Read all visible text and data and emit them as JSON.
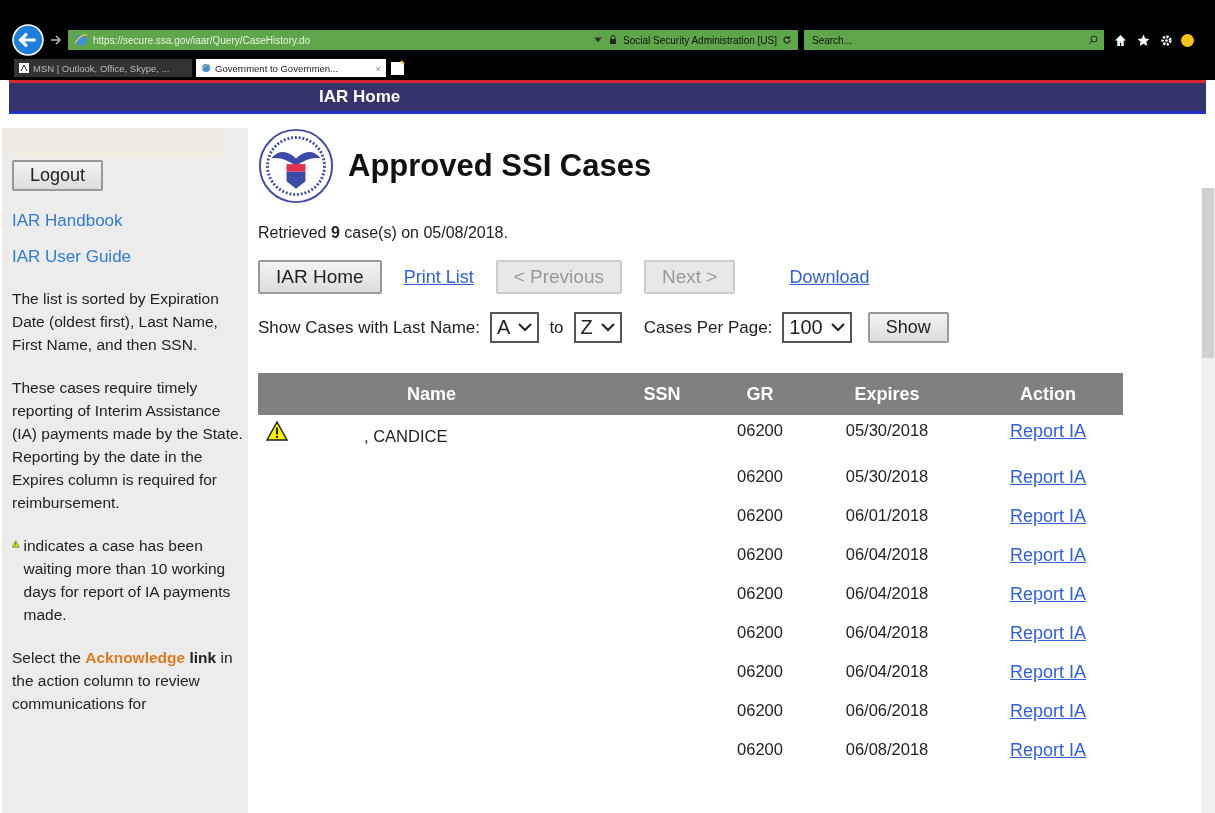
{
  "browser": {
    "url": "https://secure.ssa.gov/iaar/Query/CaseHistory.do",
    "site_identity": "Social Security Administration [US]",
    "search": {
      "placeholder": "Search..."
    },
    "tabs": [
      {
        "label": "MSN | Outlook, Office, Skype, ...",
        "selected": false
      },
      {
        "label": "Government to Governmen...",
        "selected": true,
        "close": "×"
      }
    ]
  },
  "nav_bar": {
    "label": "IAR Home"
  },
  "sidebar": {
    "logout": "Logout",
    "links": [
      "IAR Handbook",
      "IAR User Guide"
    ],
    "paragraphs": [
      {
        "kind": "text",
        "text": "The list is sorted by Expiration Date (oldest first), Last Name, First Name, and then SSN."
      },
      {
        "kind": "text",
        "text": "These cases require timely reporting of Interim Assistance (IA) payments made by the State. Reporting by the date in the Expires column is required for reimbursement."
      },
      {
        "kind": "warning",
        "text": "indicates a case has been waiting more than 10 working days for report of IA payments made."
      },
      {
        "kind": "highlight",
        "before": "Select the ",
        "highlight": "Acknowledge",
        "after": " **link** in the action column to review communications for"
      }
    ]
  },
  "page": {
    "title": "Approved SSI Cases",
    "summary": "Retrieved **9** case(s) on 05/08/2018.",
    "actions": [
      {
        "kind": "button",
        "label": "IAR Home",
        "disabled": false
      },
      {
        "kind": "link",
        "label": "Print List"
      },
      {
        "kind": "button",
        "label": "< Previous",
        "disabled": true
      },
      {
        "kind": "button",
        "label": "Next >",
        "disabled": true
      },
      {
        "kind": "link",
        "label": "Download"
      }
    ],
    "filter": {
      "label": "Show Cases with Last Name:",
      "from": "A",
      "to_label": "to",
      "to": "Z",
      "per_page_label": "Cases Per Page:",
      "per_page": "100",
      "show": "Show"
    }
  },
  "table": {
    "columns": [
      "Name",
      "SSN",
      "GR",
      "Expires",
      "Action"
    ],
    "rows": [
      {
        "warning": true,
        "name": ", CANDICE",
        "gr": "06200",
        "expires": "05/30/2018",
        "action": "Report IA"
      },
      {
        "warning": false,
        "gr": "06200",
        "expires": "05/30/2018",
        "action": "Report IA"
      },
      {
        "warning": false,
        "gr": "06200",
        "expires": "06/01/2018",
        "action": "Report IA"
      },
      {
        "warning": false,
        "gr": "06200",
        "expires": "06/04/2018",
        "action": "Report IA"
      },
      {
        "warning": false,
        "gr": "06200",
        "expires": "06/04/2018",
        "action": "Report IA"
      },
      {
        "warning": false,
        "gr": "06200",
        "expires": "06/04/2018",
        "action": "Report IA"
      },
      {
        "warning": false,
        "gr": "06200",
        "expires": "06/04/2018",
        "action": "Report IA"
      },
      {
        "warning": false,
        "gr": "06200",
        "expires": "06/06/2018",
        "action": "Report IA"
      },
      {
        "warning": false,
        "gr": "06200",
        "expires": "06/08/2018",
        "action": "Report IA"
      }
    ]
  }
}
